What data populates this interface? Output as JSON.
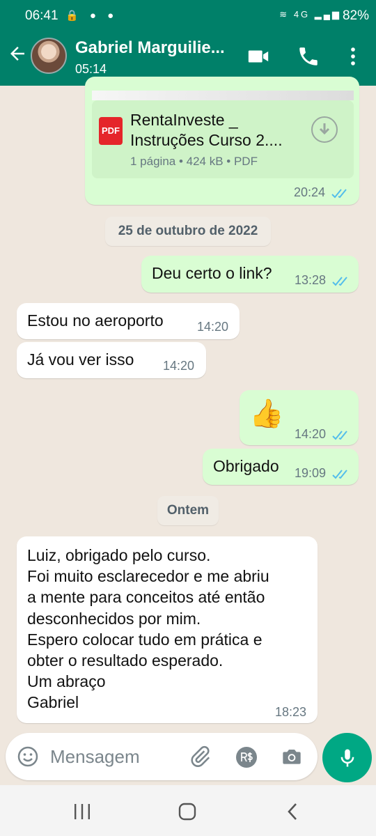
{
  "status_bar": {
    "time": "06:41",
    "battery": "82%",
    "network_label": "4G"
  },
  "header": {
    "contact_name": "Gabriel Marguilie...",
    "subtitle": "05:14"
  },
  "document": {
    "file_name_line1": "RentaInveste _",
    "file_name_line2": "Instruções Curso 2....",
    "file_info": "1 página • 424 kB • PDF",
    "badge": "PDF",
    "time": "20:24"
  },
  "date_chips": [
    "25 de outubro de 2022",
    "Ontem"
  ],
  "messages": [
    {
      "text": "Deu certo o link?",
      "time": "13:28"
    },
    {
      "text": "Estou no aeroporto",
      "time": "14:20"
    },
    {
      "text": "Já vou ver isso",
      "time": "14:20"
    },
    {
      "text": "👍",
      "time": "14:20"
    },
    {
      "text": "Obrigado",
      "time": "19:09"
    }
  ],
  "long_message": {
    "lines": [
      "Luiz, obrigado pelo curso.",
      "Foi muito esclarecedor e me abriu",
      "a mente para conceitos até então",
      "desconhecidos por mim.",
      "Espero colocar tudo em prática e",
      "obter o resultado esperado.",
      "Um abraço",
      "Gabriel"
    ],
    "time": "18:23"
  },
  "composer": {
    "placeholder": "Mensagem"
  },
  "colors": {
    "header": "#008069",
    "outgoing": "#d9fdd3",
    "incoming": "#ffffff",
    "accent": "#00a884",
    "read_ticks": "#53bdeb"
  }
}
